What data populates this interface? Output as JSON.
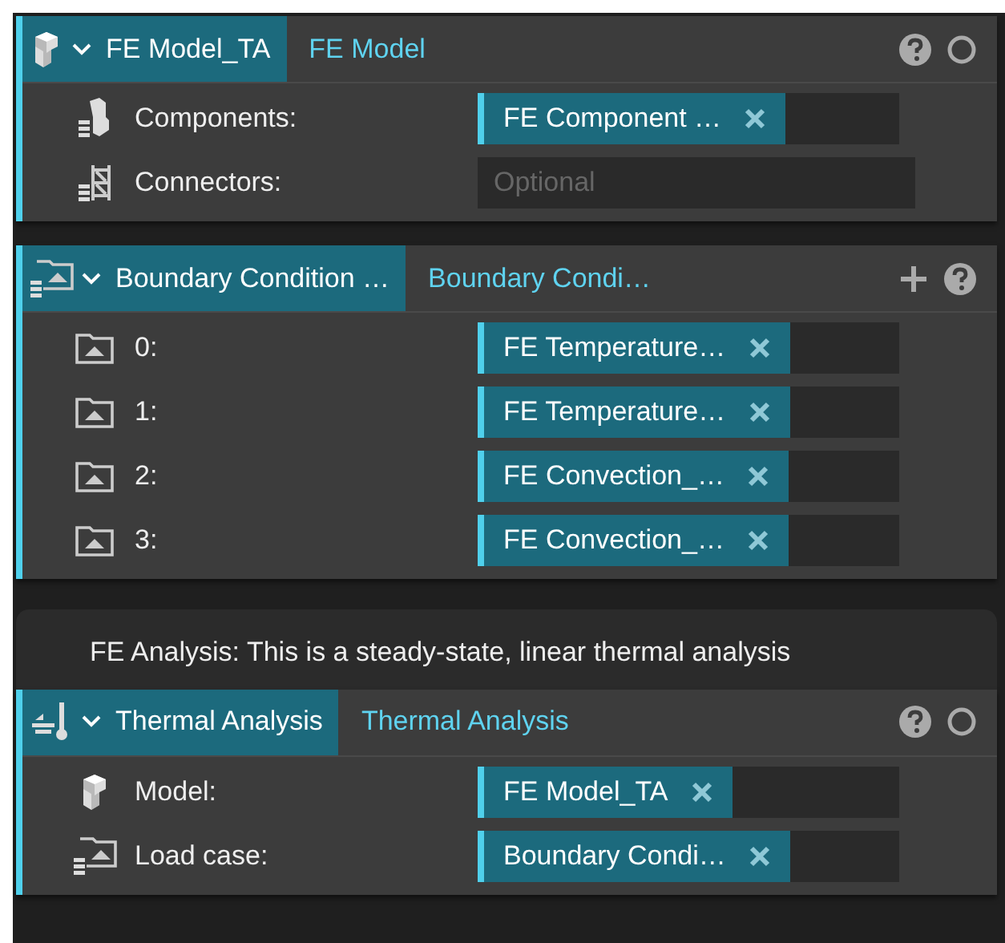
{
  "blocks": [
    {
      "kind": "node",
      "title": "FE Model_TA",
      "type_label": "FE Model",
      "actions": [
        {
          "kind": "help"
        },
        {
          "kind": "toggle"
        }
      ],
      "rows": [
        {
          "label": "Components:",
          "value": "FE Component …"
        },
        {
          "label": "Connectors:",
          "placeholder": "Optional"
        }
      ]
    },
    {
      "kind": "node",
      "title": "Boundary Condition …",
      "type_label": "Boundary Condi…",
      "actions": [
        {
          "kind": "add"
        },
        {
          "kind": "help"
        }
      ],
      "rows": [
        {
          "label": "0:",
          "value": "FE Temperature…"
        },
        {
          "label": "1:",
          "value": "FE Temperature…"
        },
        {
          "label": "2:",
          "value": "FE Convection_…"
        },
        {
          "label": "3:",
          "value": "FE Convection_…"
        }
      ]
    },
    {
      "kind": "comment",
      "text": "FE Analysis: This is a steady-state, linear thermal analysis"
    },
    {
      "kind": "node",
      "title": "Thermal Analysis",
      "type_label": "Thermal Analysis",
      "actions": [
        {
          "kind": "help"
        },
        {
          "kind": "toggle"
        }
      ],
      "rows": [
        {
          "label": "Model:",
          "value": "FE Model_TA"
        },
        {
          "label": "Load case:",
          "value": "Boundary Condi…"
        }
      ]
    }
  ]
}
